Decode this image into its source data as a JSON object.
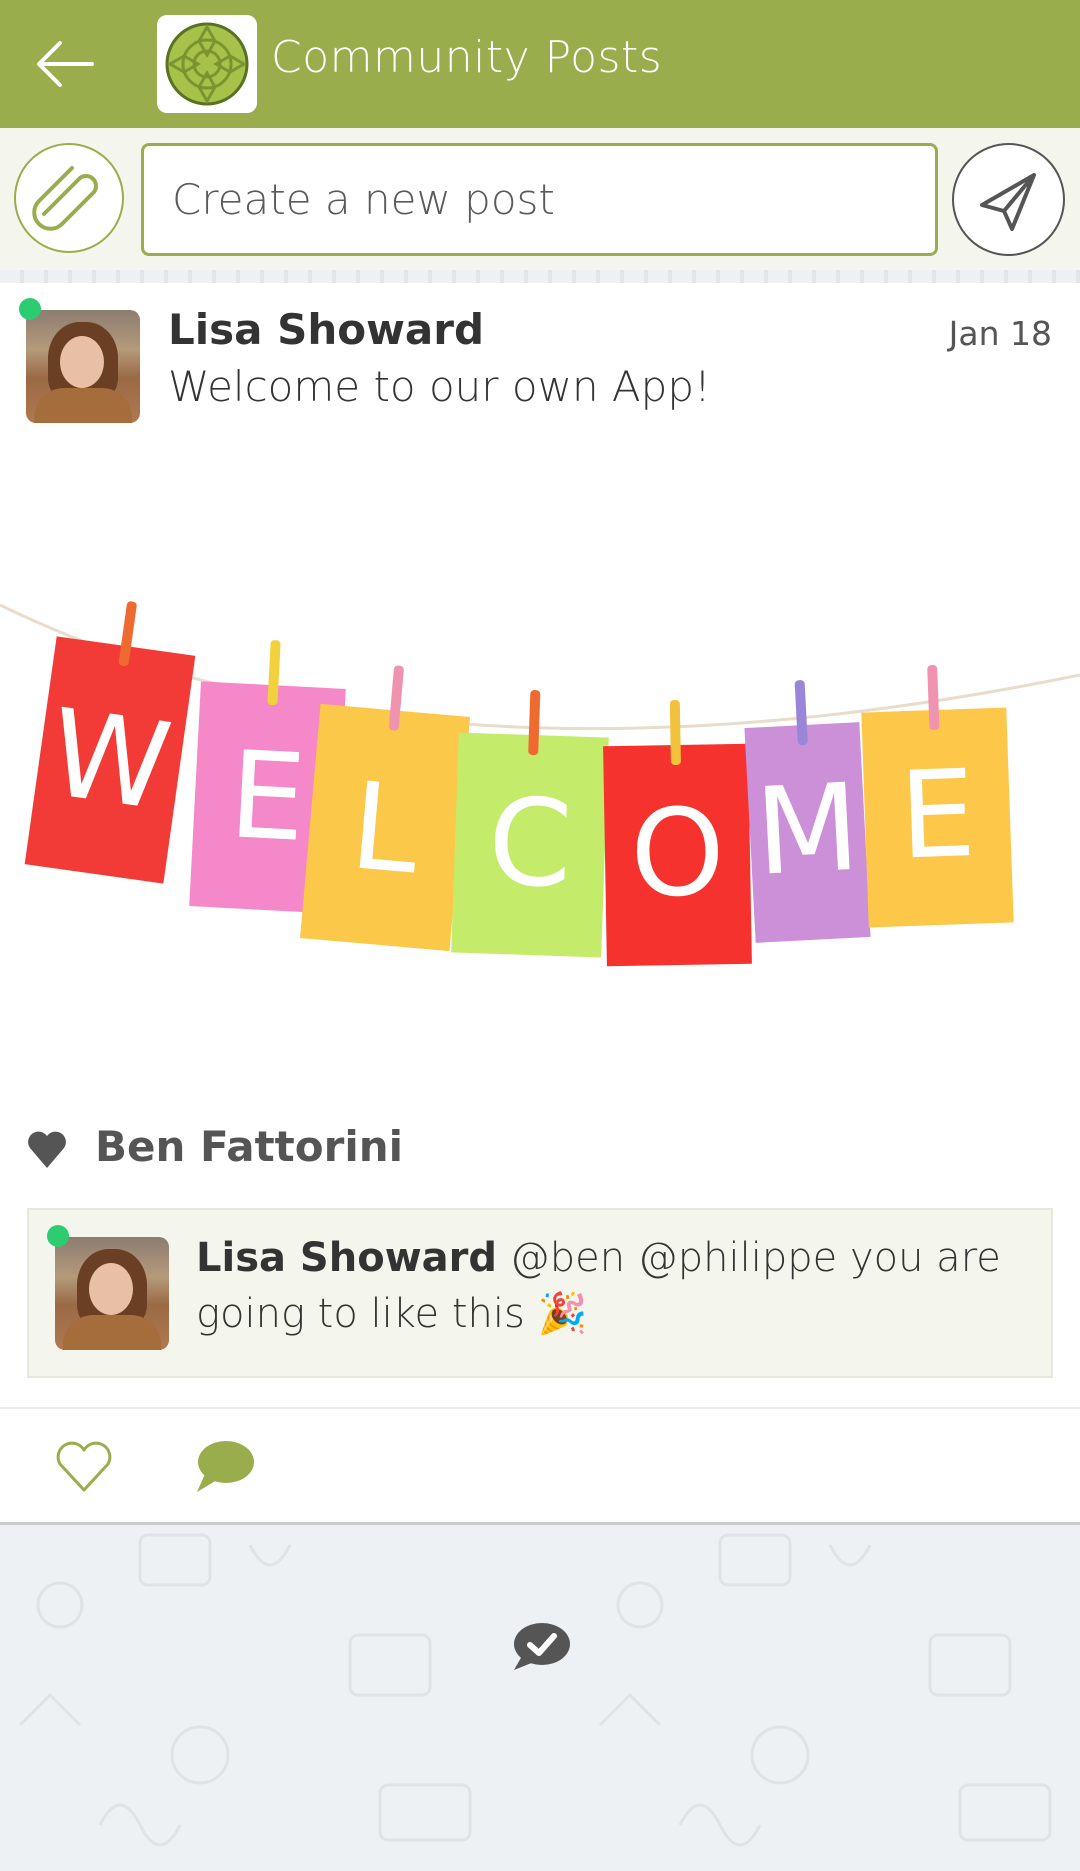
{
  "header": {
    "title": "Community Posts",
    "back_icon": "arrow-left-icon",
    "logo_icon": "celtic-knot-logo",
    "color": "#9aad4c"
  },
  "composer": {
    "placeholder": "Create a new post",
    "value": "",
    "attach_icon": "paperclip-icon",
    "send_icon": "paper-plane-icon"
  },
  "post": {
    "author": "Lisa Showard",
    "online": true,
    "date": "Jan 18",
    "message": "Welcome to our own App!",
    "image": {
      "description": "Colorful paper cards on a clothesline spelling WELCOME",
      "letters": [
        "W",
        "E",
        "L",
        "C",
        "O",
        "M",
        "E"
      ],
      "card_colors": [
        "#f23a36",
        "#f588c8",
        "#fbc84a",
        "#c4ec6a",
        "#f5322e",
        "#cc90d8",
        "#fdc84a"
      ],
      "pin_colors": [
        "#ef6a30",
        "#f2d23c",
        "#f093b0",
        "#ef6a30",
        "#f2c23c",
        "#9a86d8",
        "#f093b0"
      ]
    },
    "likes": {
      "icon": "heart-filled-icon",
      "names": "Ben Fattorini"
    },
    "comments": [
      {
        "author": "Lisa Showard",
        "online": true,
        "text": "@ben @philippe you are going to like this 🎉"
      }
    ],
    "actions": {
      "like_icon": "heart-outline-icon",
      "comment_icon": "speech-bubble-icon"
    }
  },
  "footer": {
    "status_icon": "chat-check-icon"
  },
  "colors": {
    "accent": "#9aad4c",
    "online": "#2ecc71",
    "text": "#333333",
    "muted": "#555555",
    "composer_bg": "#f4f5ec"
  }
}
